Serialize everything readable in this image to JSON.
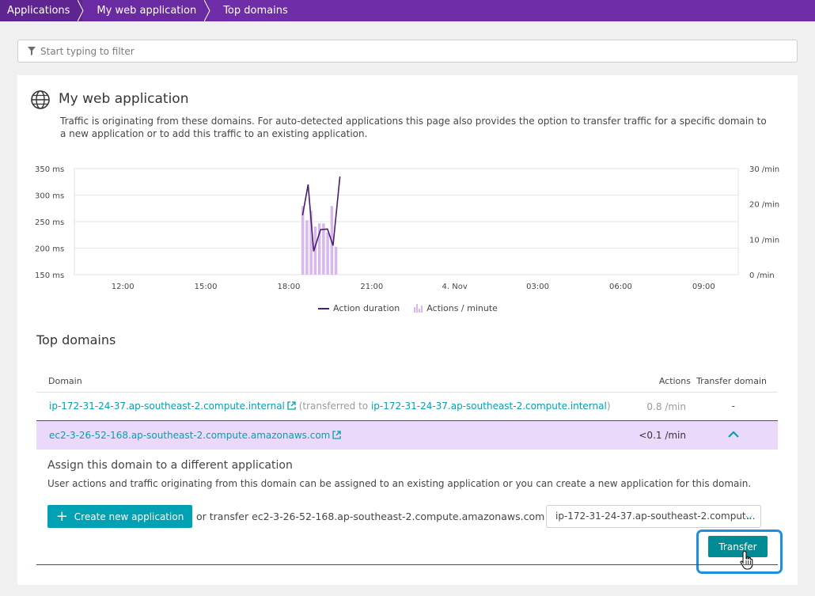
{
  "breadcrumb": [
    "Applications",
    "My web application",
    "Top domains"
  ],
  "filter": {
    "placeholder": "Start typing to filter"
  },
  "app": {
    "title": "My web application",
    "description": "Traffic is originating from these domains. For auto-detected applications this page also provides the option to transfer traffic for a specific domain to a new application or to add this traffic to an existing application."
  },
  "chart_data": {
    "type": "bar+line",
    "x_ticks": [
      "12:00",
      "15:00",
      "18:00",
      "21:00",
      "4. Nov",
      "03:00",
      "06:00",
      "09:00"
    ],
    "y_left": {
      "ticks": [
        "350 ms",
        "300 ms",
        "250 ms",
        "200 ms",
        "150 ms"
      ],
      "range": [
        150,
        350
      ],
      "unit": "ms"
    },
    "y_right": {
      "ticks": [
        "30 /min",
        "20 /min",
        "10 /min",
        "0 /min"
      ],
      "range": [
        0,
        30
      ],
      "unit": "/min"
    },
    "series": [
      {
        "name": "Action duration",
        "type": "line",
        "color": "#4b1f6d",
        "points": [
          [
            18.5,
            262
          ],
          [
            18.7,
            320
          ],
          [
            18.9,
            194
          ],
          [
            19.15,
            235
          ],
          [
            19.4,
            236
          ],
          [
            19.6,
            205
          ],
          [
            19.85,
            335
          ]
        ]
      },
      {
        "name": "Actions / minute",
        "type": "bar",
        "color": "#d8b8ee",
        "points": [
          [
            18.5,
            19.4
          ],
          [
            18.65,
            15.4
          ],
          [
            18.8,
            18.1
          ],
          [
            18.95,
            13.6
          ],
          [
            19.1,
            14.5
          ],
          [
            19.25,
            14.5
          ],
          [
            19.4,
            11.9
          ],
          [
            19.55,
            19.4
          ],
          [
            19.7,
            7.9
          ]
        ]
      }
    ],
    "grid": true,
    "legend_position": "bottom"
  },
  "legend": {
    "line": "Action duration",
    "bars": "Actions / minute"
  },
  "section": {
    "title": "Top domains"
  },
  "table": {
    "headers": {
      "domain": "Domain",
      "actions": "Actions",
      "transfer": "Transfer domain"
    },
    "rows": [
      {
        "domain": "ip-172-31-24-37.ap-southeast-2.compute.internal",
        "note_prefix": "(transferred to",
        "note_target": "ip-172-31-24-37.ap-southeast-2.compute.internal",
        "note_suffix": ")",
        "actions": "0.8 /min",
        "transfer": "-"
      },
      {
        "domain": "ec2-3-26-52-168.ap-southeast-2.compute.amazonaws.com",
        "actions": "<0.1 /min"
      }
    ]
  },
  "assign": {
    "title": "Assign this domain to a different application",
    "description": "User actions and traffic originating from this domain can be assigned to an existing application or you can create a new application for this domain.",
    "create_button": "Create new application",
    "transfer_text": "or transfer ec2-3-26-52-168.ap-southeast-2.compute.amazonaws.com to",
    "selected_app": "ip-172-31-24-37.ap-southeast-2.comput…",
    "transfer_button": "Transfer"
  },
  "colors": {
    "brand": "#6f2da8",
    "accent": "#00a1b2",
    "selected_row": "#ebd9fb",
    "focus": "#1e8fe0"
  }
}
